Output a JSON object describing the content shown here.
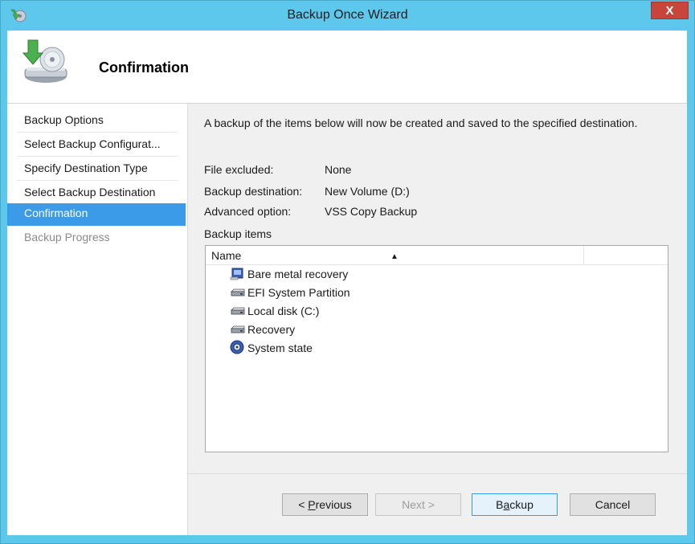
{
  "window": {
    "title": "Backup Once Wizard",
    "close_label": "X"
  },
  "header": {
    "title": "Confirmation"
  },
  "nav": {
    "items": [
      {
        "label": "Backup Options",
        "state": "normal"
      },
      {
        "label": "Select Backup Configurat...",
        "state": "normal"
      },
      {
        "label": "Specify Destination Type",
        "state": "normal"
      },
      {
        "label": "Select Backup Destination",
        "state": "normal"
      },
      {
        "label": "Confirmation",
        "state": "selected"
      },
      {
        "label": "Backup Progress",
        "state": "disabled"
      }
    ]
  },
  "content": {
    "description": "A backup of the items below will now be created and saved to the specified destination.",
    "details": [
      {
        "key": "File excluded:",
        "value": "None"
      },
      {
        "key": "Backup destination:",
        "value": "New Volume (D:)"
      },
      {
        "key": "Advanced option:",
        "value": "VSS Copy Backup"
      }
    ],
    "items_label": "Backup items",
    "list": {
      "column_header": "Name",
      "sort_icon": "sort-ascending-icon",
      "items": [
        {
          "label": "Bare metal recovery",
          "icon": "bare-metal-recovery-icon"
        },
        {
          "label": "EFI System Partition",
          "icon": "drive-icon"
        },
        {
          "label": "Local disk (C:)",
          "icon": "drive-icon"
        },
        {
          "label": "Recovery",
          "icon": "drive-icon"
        },
        {
          "label": "System state",
          "icon": "system-state-icon"
        }
      ]
    }
  },
  "buttons": {
    "previous": {
      "label_prefix": "< ",
      "label_accel": "P",
      "label_rest": "revious"
    },
    "next": {
      "label": "Next >"
    },
    "backup": {
      "label_prefix": "B",
      "label_accel": "a",
      "label_rest": "ckup"
    },
    "cancel": {
      "label": "Cancel"
    }
  },
  "colors": {
    "titlebar": "#5ec8ec",
    "selected": "#3c9be8",
    "close": "#c7453a"
  }
}
